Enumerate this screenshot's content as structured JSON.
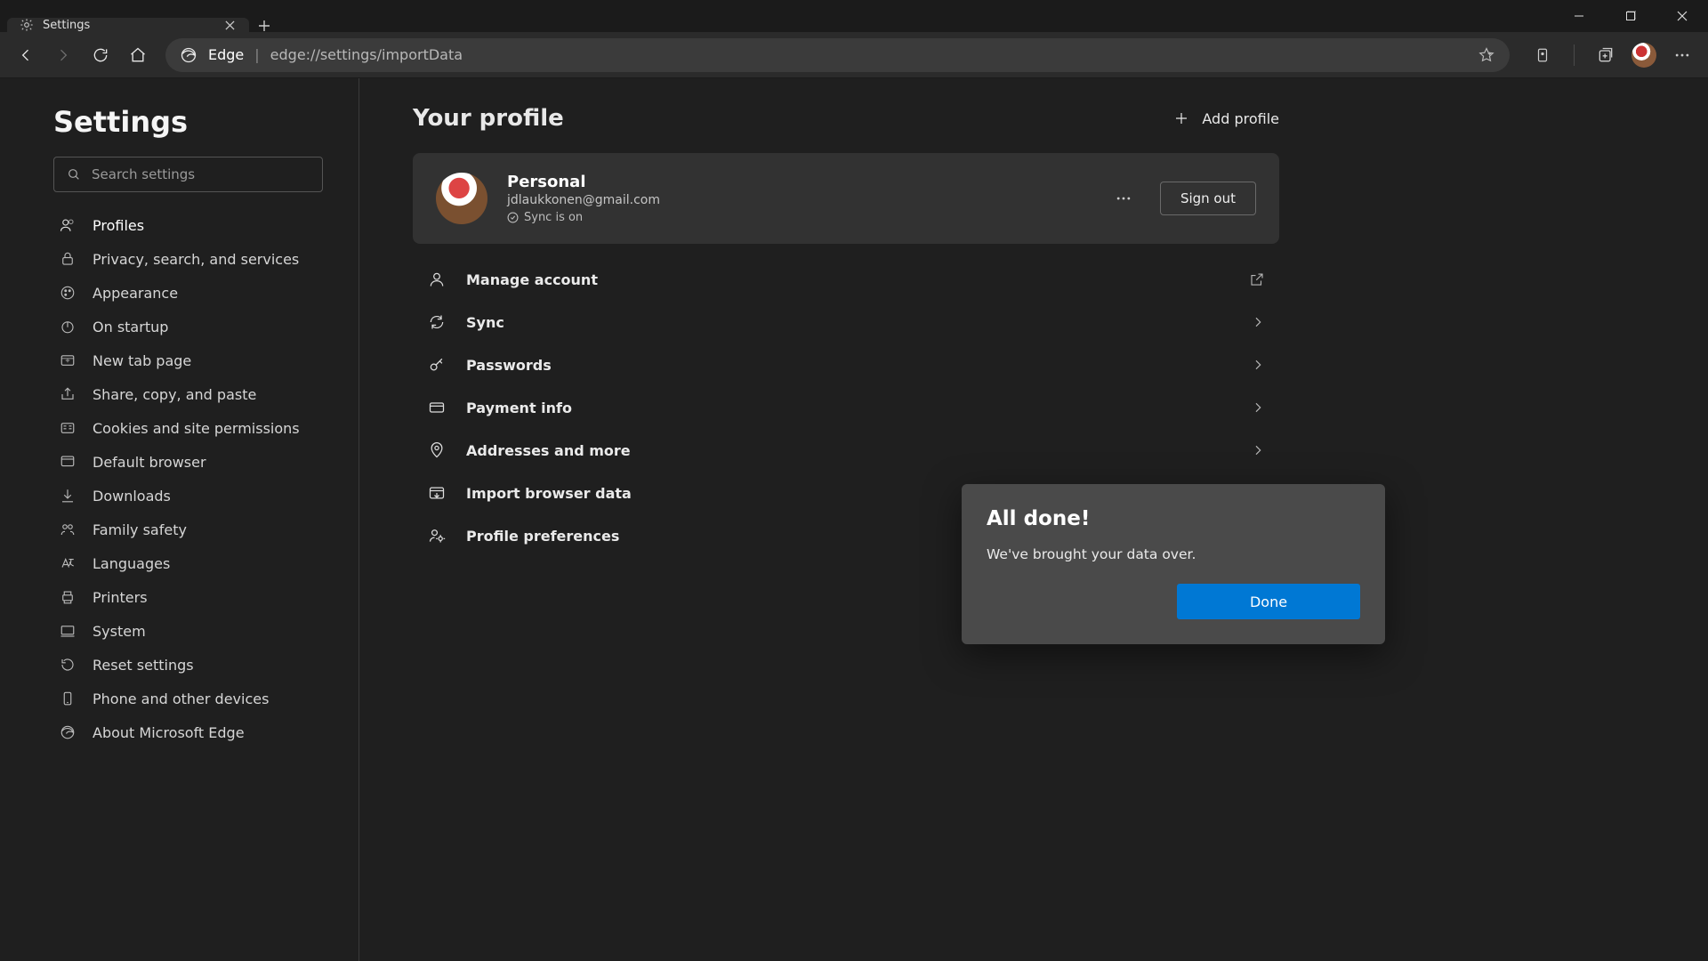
{
  "tab": {
    "title": "Settings"
  },
  "addr": {
    "label": "Edge",
    "url": "edge://settings/importData"
  },
  "sidebar": {
    "title": "Settings",
    "search_placeholder": "Search settings",
    "items": [
      {
        "label": "Profiles"
      },
      {
        "label": "Privacy, search, and services"
      },
      {
        "label": "Appearance"
      },
      {
        "label": "On startup"
      },
      {
        "label": "New tab page"
      },
      {
        "label": "Share, copy, and paste"
      },
      {
        "label": "Cookies and site permissions"
      },
      {
        "label": "Default browser"
      },
      {
        "label": "Downloads"
      },
      {
        "label": "Family safety"
      },
      {
        "label": "Languages"
      },
      {
        "label": "Printers"
      },
      {
        "label": "System"
      },
      {
        "label": "Reset settings"
      },
      {
        "label": "Phone and other devices"
      },
      {
        "label": "About Microsoft Edge"
      }
    ]
  },
  "main": {
    "heading": "Your profile",
    "add_profile": "Add profile",
    "profile": {
      "name": "Personal",
      "email": "jdlaukkonen@gmail.com",
      "sync": "Sync is on",
      "signout": "Sign out"
    },
    "rows": [
      {
        "label": "Manage account",
        "trailing": "external"
      },
      {
        "label": "Sync",
        "trailing": "chevron"
      },
      {
        "label": "Passwords",
        "trailing": "chevron"
      },
      {
        "label": "Payment info",
        "trailing": "chevron"
      },
      {
        "label": "Addresses and more",
        "trailing": "chevron"
      },
      {
        "label": "Import browser data",
        "trailing": "chevron"
      },
      {
        "label": "Profile preferences",
        "trailing": "chevron"
      }
    ]
  },
  "dialog": {
    "title": "All done!",
    "body": "We've brought your data over.",
    "done": "Done"
  }
}
